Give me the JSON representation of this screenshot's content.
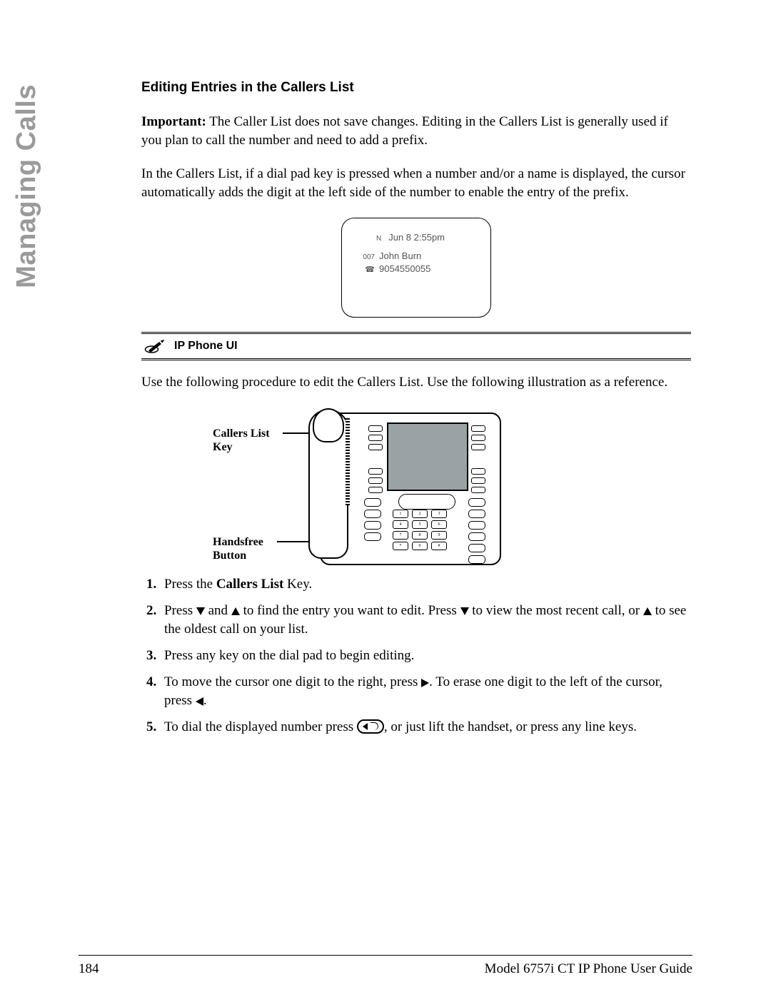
{
  "sideTab": "Managing Calls",
  "title": "Editing Entries in the Callers List",
  "para1_lead": "Important:",
  "para1_rest": " The Caller List does not save changes. Editing in the Callers List is generally used if you plan to call the number and need to add a prefix.",
  "para2": "In the Callers List, if a dial pad key is pressed when a number and/or a name is displayed, the cursor automatically adds the digit at the left side of the number to enable the entry of the prefix.",
  "lcd": {
    "n_glyph": "N",
    "datetime": "Jun 8 2:55pm",
    "index": "007",
    "name": "John Burn",
    "phone_glyph": "☎",
    "number": "9054550055"
  },
  "ipPhoneUI": "IP Phone UI",
  "para3": "Use the following procedure to edit the Callers List. Use the following illustration as a reference.",
  "callouts": {
    "callersListKey": "Callers List Key",
    "handsfreeButton": "Handsfree Button"
  },
  "steps": {
    "s1_a": "Press the ",
    "s1_b": "Callers List",
    "s1_c": " Key.",
    "s2_a": "Press ",
    "s2_b": " and ",
    "s2_c": " to find the entry you want to edit. Press ",
    "s2_d": " to view the most recent call, or ",
    "s2_e": " to see the oldest call on your list.",
    "s3": "Press any key on the dial pad to begin editing.",
    "s4_a": "To move the cursor one digit to the right, press ",
    "s4_b": ". To erase one digit to the left of the cursor, press ",
    "s4_c": ".",
    "s5_a": "To dial the displayed number press ",
    "s5_b": ", or just lift the handset, or press any line keys."
  },
  "footer": {
    "pageNum": "184",
    "guide": "Model 6757i CT IP Phone User Guide"
  }
}
